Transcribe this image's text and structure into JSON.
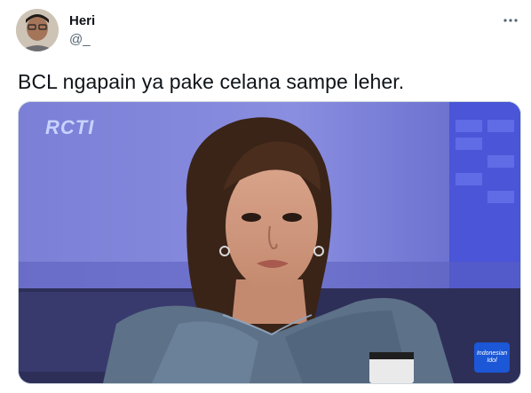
{
  "tweet": {
    "author": {
      "name": "Heri",
      "handle": "@_"
    },
    "text": "BCL ngapain ya pake celana sampe leher.",
    "media": {
      "channel_logo": "RCTI",
      "badge": "Indonesian Idol"
    }
  }
}
